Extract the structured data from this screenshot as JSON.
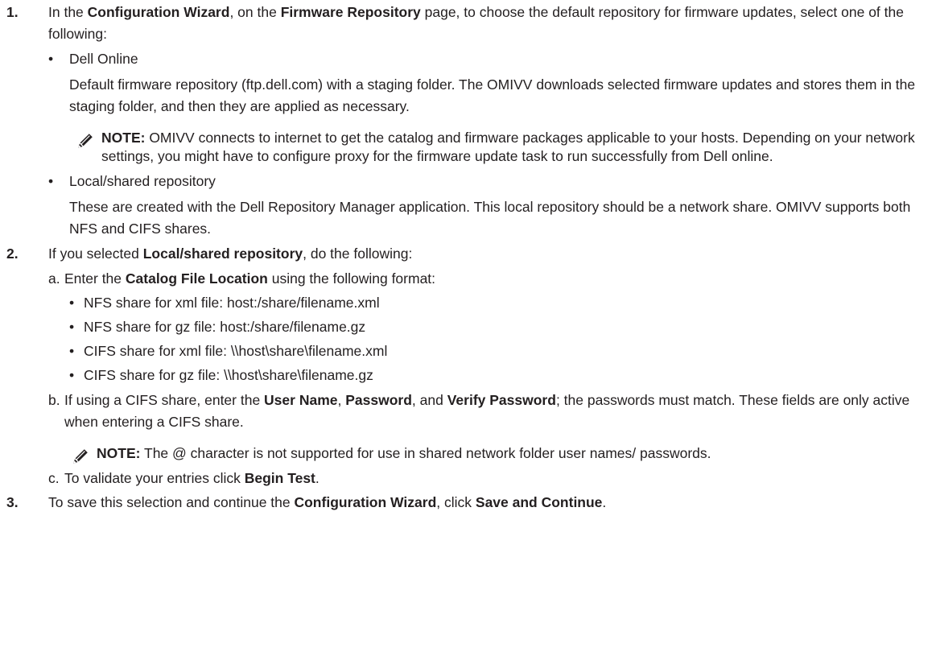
{
  "steps": [
    {
      "number": "1.",
      "parts": [
        "In the ",
        "Configuration Wizard",
        ", on the ",
        "Firmware Repository",
        " page, to choose the default repository for firmware updates, select one of the following:"
      ],
      "options": [
        {
          "title": "Dell Online",
          "description": "Default firmware repository (ftp.dell.com) with a staging folder. The OMIVV downloads selected firmware updates and stores them in the staging folder, and then they are applied as necessary.",
          "note": {
            "label": "NOTE:",
            "text": " OMIVV connects to internet to get the catalog and firmware packages applicable to your hosts. Depending on your network settings, you might have to configure proxy for the firmware update task to run successfully from Dell online."
          }
        },
        {
          "title": "Local/shared repository",
          "description": "These are created with the Dell Repository Manager application. This local repository should be a network share. OMIVV supports both NFS and CIFS shares."
        }
      ]
    },
    {
      "number": "2.",
      "parts": [
        "If you selected ",
        "Local/shared repository",
        ", do the following:"
      ],
      "substeps": [
        {
          "letter": "a.",
          "parts": [
            "Enter the ",
            "Catalog File Location",
            " using the following format:"
          ],
          "bullets": [
            "NFS share for xml file: host:/share/filename.xml",
            "NFS share for gz file: host:/share/filename.gz",
            "CIFS share for xml file: \\\\host\\share\\filename.xml",
            "CIFS share for gz file: \\\\host\\share\\filename.gz"
          ]
        },
        {
          "letter": "b.",
          "parts": [
            "If using a CIFS share, enter the ",
            "User Name",
            ", ",
            "Password",
            ", and ",
            "Verify Password",
            "; the passwords must match. These fields are only active when entering a CIFS share."
          ],
          "note": {
            "label": "NOTE:",
            "text": " The @ character is not supported for use in shared network folder user names/ passwords."
          }
        },
        {
          "letter": "c.",
          "parts": [
            "To validate your entries click ",
            "Begin Test",
            "."
          ]
        }
      ]
    },
    {
      "number": "3.",
      "parts": [
        "To save this selection and continue the ",
        "Configuration Wizard",
        ", click ",
        "Save and Continue",
        "."
      ]
    }
  ],
  "bullet_glyph": "•",
  "icons": {
    "note": "note-pencil-icon"
  },
  "colors": {
    "text": "#231f20",
    "background": "#ffffff"
  }
}
